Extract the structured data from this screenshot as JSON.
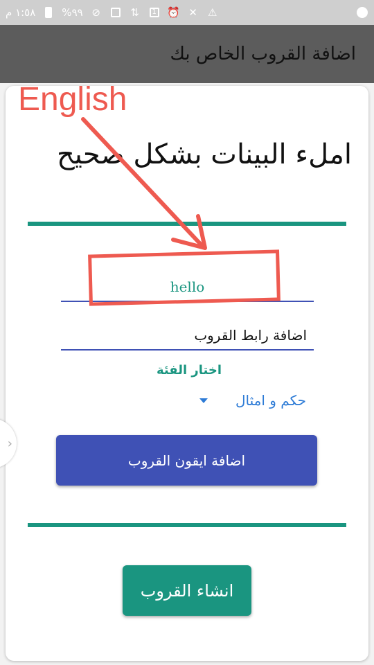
{
  "status_bar": {
    "time": "١:٥٨ م",
    "battery": "%٩٩",
    "icons": [
      "battery-icon",
      "no-symbol-icon",
      "data-icon",
      "signal-icon",
      "sim-icon",
      "alarm-icon",
      "mute-icon",
      "alert-icon",
      "settings-icon"
    ]
  },
  "toolbar": {
    "title": "اضافة القروب الخاص بك"
  },
  "form": {
    "heading": "املء البينات بشكل صحيح",
    "group_name_value": "hello",
    "group_link_value": "اضافة رابط القروب",
    "category_label": "اختار الفئة",
    "category_selected": "حكم و امثال",
    "add_icon_button": "اضافة ايقون القروب",
    "create_button": "انشاء القروب"
  },
  "annotation": {
    "label": "English",
    "color": "#ee5a50"
  },
  "colors": {
    "accent_teal": "#1a9580",
    "primary_indigo": "#3f51b5",
    "toolbar": "#5c5c5c"
  }
}
